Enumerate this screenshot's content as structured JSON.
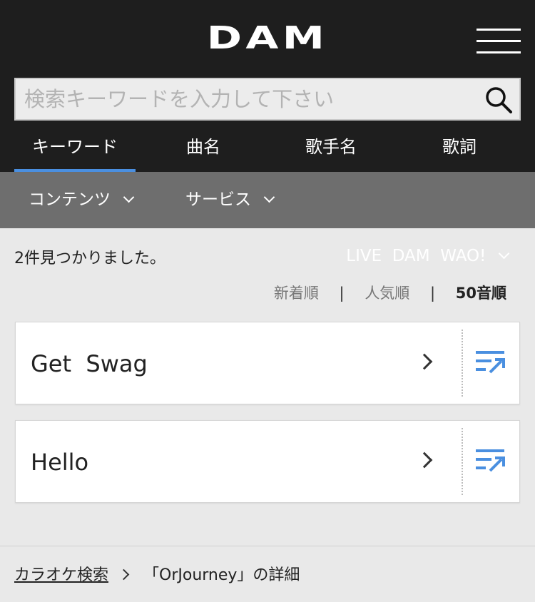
{
  "header": {
    "logo": "DAM"
  },
  "search": {
    "placeholder": "検索キーワードを入力して下さい",
    "value": ""
  },
  "tabs": [
    {
      "label": "キーワード",
      "active": true
    },
    {
      "label": "曲名",
      "active": false
    },
    {
      "label": "歌手名",
      "active": false
    },
    {
      "label": "歌詞",
      "active": false
    }
  ],
  "subnav": [
    {
      "label": "コンテンツ"
    },
    {
      "label": "サービス"
    },
    {
      "label": "LIVE  DAM  WAO!"
    }
  ],
  "results": {
    "count_text": "2件見つかりました。",
    "sort": {
      "options": [
        "新着順",
        "人気順",
        "50音順"
      ],
      "separator": "|",
      "active": "50音順"
    },
    "items": [
      {
        "title": "Get  Swag"
      },
      {
        "title": "Hello"
      }
    ]
  },
  "breadcrumb": {
    "root": "カラオケ検索",
    "current": "「OrJourney」の詳細"
  },
  "colors": {
    "header_bg": "#1e1e1e",
    "subnav_bg": "#6e6e6e",
    "accent": "#4a8fe0",
    "page_bg": "#e9e9e9"
  }
}
